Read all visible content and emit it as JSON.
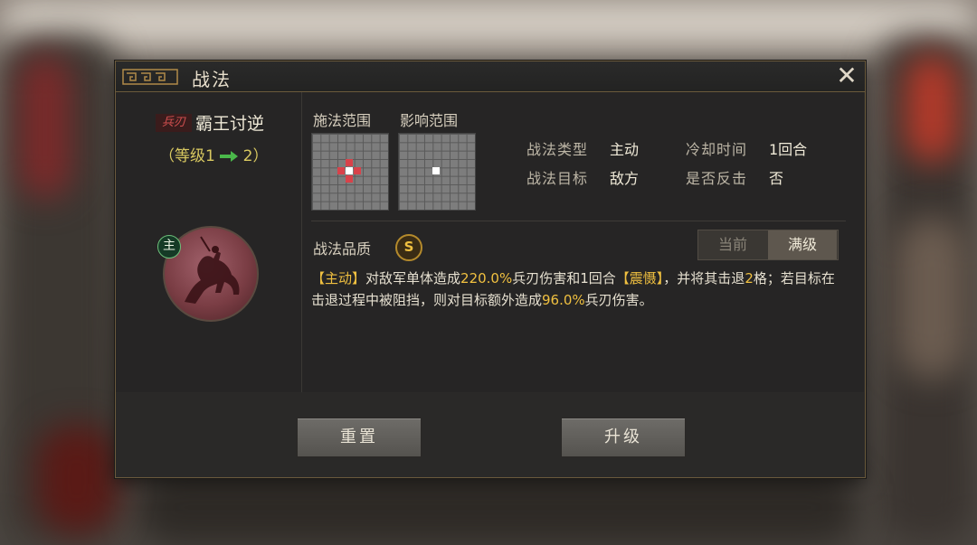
{
  "dialog": {
    "title": "战法",
    "close_glyph": "✕"
  },
  "skill": {
    "type_tag": "兵刃",
    "name": "霸王讨逆",
    "level_prefix": "（等级1",
    "level_suffix": "2）",
    "role_badge": "主"
  },
  "range": {
    "cast_label": "施法范围",
    "effect_label": "影响范围"
  },
  "info": {
    "type_label": "战法类型",
    "type_value": "主动",
    "target_label": "战法目标",
    "target_value": "敌方",
    "cooldown_label": "冷却时间",
    "cooldown_value": "1回合",
    "counter_label": "是否反击",
    "counter_value": "否"
  },
  "quality": {
    "label": "战法品质",
    "grade": "S"
  },
  "tabs": {
    "current": "当前",
    "max": "满级"
  },
  "description": {
    "p1": "【主动】",
    "p2": "对敌军单体造成",
    "p3": "220.0%",
    "p4": "兵刃伤害和1回合",
    "p5": "【震慑】",
    "p6": "，并将其击退",
    "p7": "2",
    "p8": "格；若目标在击退过程中被阻挡，则对目标额外造成",
    "p9": "96.0%",
    "p10": "兵刃伤害。"
  },
  "buttons": {
    "reset": "重置",
    "upgrade": "升级"
  },
  "colors": {
    "accent_gold": "#f0c040",
    "range_red": "#d8424a",
    "level_arrow_green": "#4ab84a"
  }
}
